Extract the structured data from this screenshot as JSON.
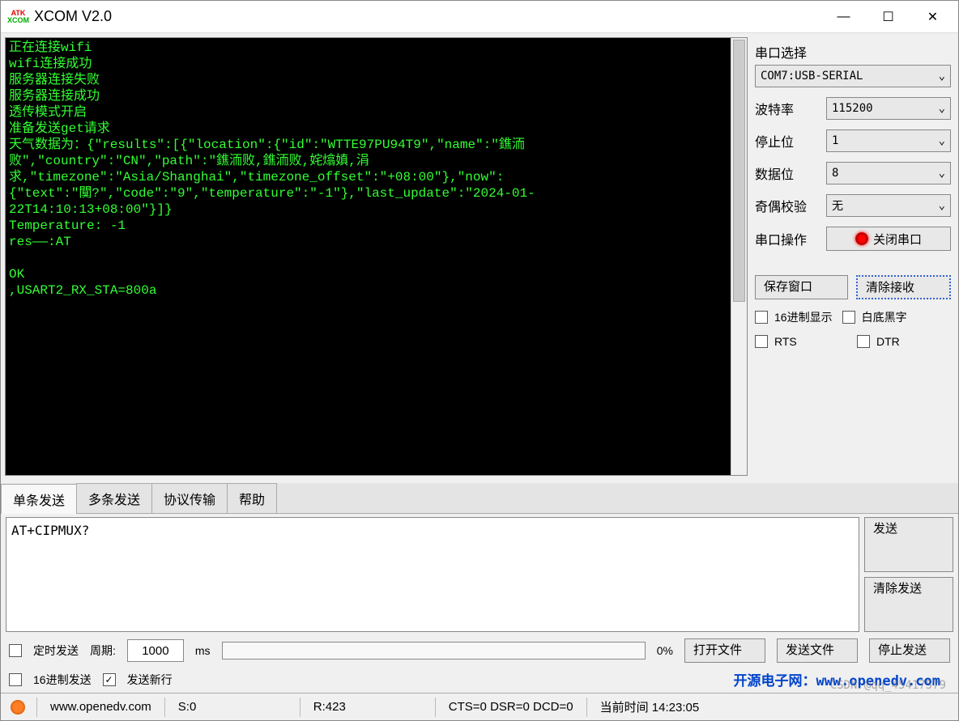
{
  "window": {
    "title": "XCOM V2.0",
    "logo_top": "ATK",
    "logo_bot": "XCOM"
  },
  "terminal": {
    "content": "正在连接wifi\nwifi连接成功\n服务器连接失败\n服务器连接成功\n透传模式开启\n准备发送get请求\n天气数据为：{\"results\":[{\"location\":{\"id\":\"WTTE97PU94T9\",\"name\":\"鐎洏\n败\",\"country\":\"CN\",\"path\":\"鐎洏败,鐎洏败,姹熻嫃,涓\n求,\"timezone\":\"Asia/Shanghai\",\"timezone_offset\":\"+08:00\"},\"now\":\n{\"text\":\"闃?\",\"code\":\"9\",\"temperature\":\"-1\"},\"last_update\":\"2024-01-\n22T14:10:13+08:00\"}]}\nTemperature: -1\nres——:AT\n\nOK\n,USART2_RX_STA=800a\n"
  },
  "port": {
    "group_title": "串口选择",
    "select_value": "COM7:USB-SERIAL",
    "baud_label": "波特率",
    "baud_value": "115200",
    "stop_label": "停止位",
    "stop_value": "1",
    "data_label": "数据位",
    "data_value": "8",
    "parity_label": "奇偶校验",
    "parity_value": "无",
    "op_label": "串口操作",
    "op_button": "关闭串口"
  },
  "buttons": {
    "save_window": "保存窗口",
    "clear_recv": "清除接收"
  },
  "checks": {
    "hex_display": "16进制显示",
    "white_bg": "白底黑字",
    "rts": "RTS",
    "dtr": "DTR"
  },
  "tabs": {
    "single": "单条发送",
    "multi": "多条发送",
    "protocol": "协议传输",
    "help": "帮助"
  },
  "send": {
    "text": "AT+CIPMUX?",
    "send_btn": "发送",
    "clear_btn": "清除发送"
  },
  "opts": {
    "timed_send": "定时发送",
    "period_label": "周期:",
    "period_value": "1000",
    "period_unit": "ms",
    "progress_pct": "0%",
    "open_file": "打开文件",
    "send_file": "发送文件",
    "stop_send": "停止发送",
    "hex_send": "16进制发送",
    "send_newline": "发送新行",
    "link": "开源电子网：www.openedv.com"
  },
  "status": {
    "url": "www.openedv.com",
    "s": "S:0",
    "r": "R:423",
    "lines": "CTS=0 DSR=0 DCD=0",
    "time": "当前时间 14:23:05",
    "watermark": "CSDN @qq_45417579"
  }
}
